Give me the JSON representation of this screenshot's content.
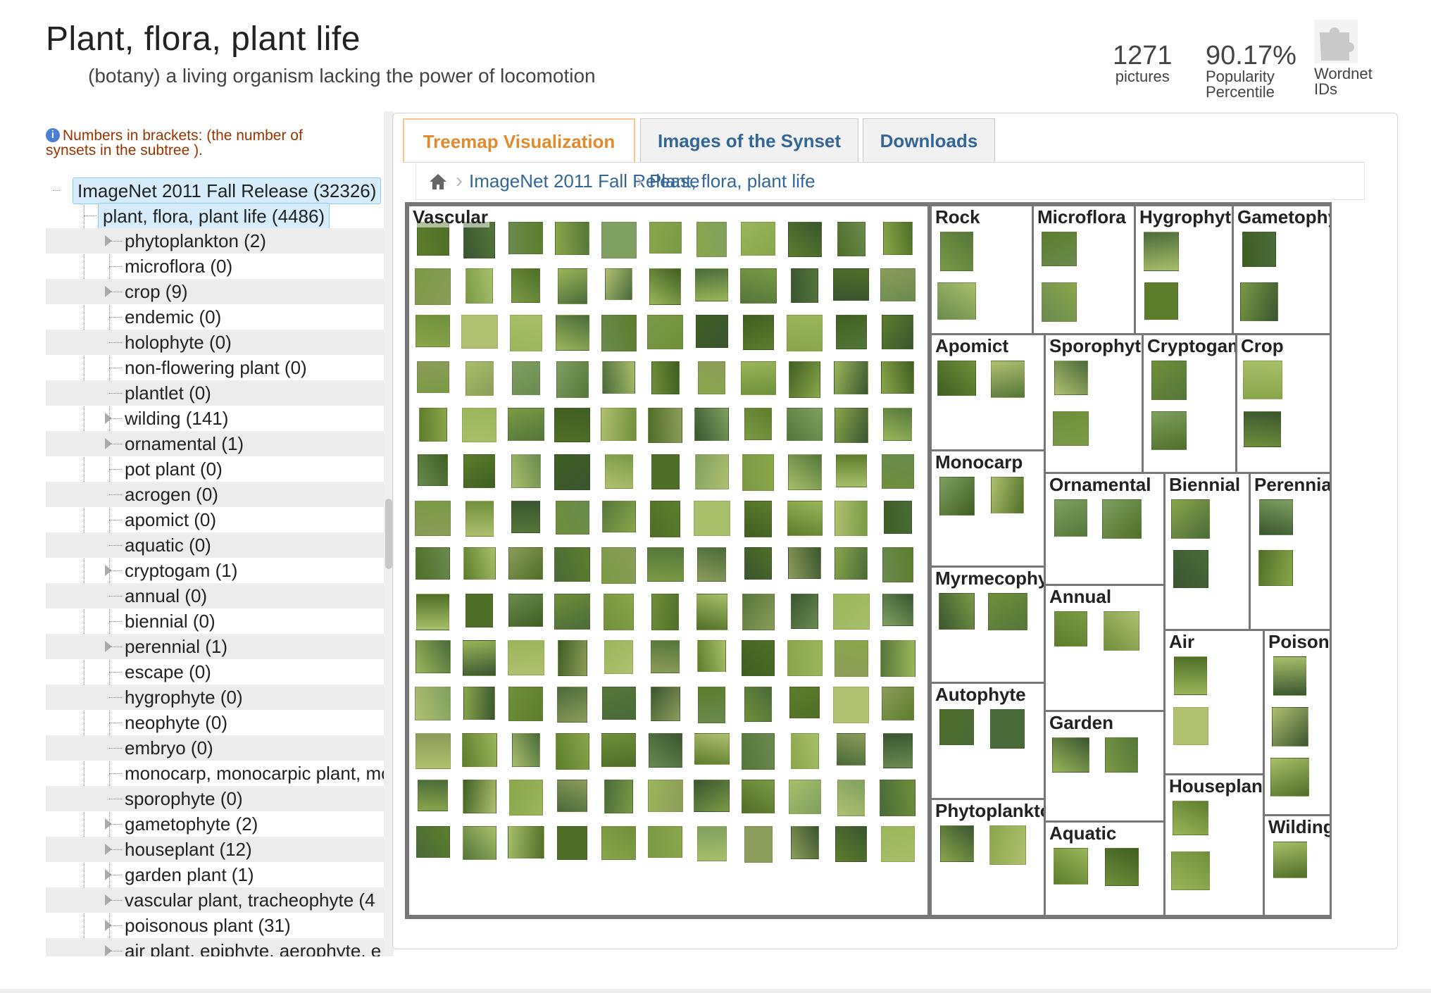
{
  "header": {
    "title": "Plant, flora, plant life",
    "gloss": "(botany) a living organism lacking the power of locomotion",
    "stats": {
      "pictures_count": "1271",
      "pictures_label": "pictures",
      "popularity_value": "90.17%",
      "popularity_label_1": "Popularity",
      "popularity_label_2": "Percentile",
      "wordnet_label_1": "Wordnet",
      "wordnet_label_2": "IDs"
    }
  },
  "tree": {
    "note": "Numbers in brackets: (the number of synsets in the subtree ).",
    "root": "ImageNet 2011 Fall Release (32326)",
    "current": "plant, flora, plant life (4486)",
    "children": [
      {
        "label": "phytoplankton (2)",
        "expandable": true
      },
      {
        "label": "microflora (0)",
        "expandable": false
      },
      {
        "label": "crop (9)",
        "expandable": true
      },
      {
        "label": "endemic (0)",
        "expandable": false
      },
      {
        "label": "holophyte (0)",
        "expandable": false
      },
      {
        "label": "non-flowering plant (0)",
        "expandable": false
      },
      {
        "label": "plantlet (0)",
        "expandable": false
      },
      {
        "label": "wilding (141)",
        "expandable": true
      },
      {
        "label": "ornamental (1)",
        "expandable": true
      },
      {
        "label": "pot plant (0)",
        "expandable": false
      },
      {
        "label": "acrogen (0)",
        "expandable": false
      },
      {
        "label": "apomict (0)",
        "expandable": false
      },
      {
        "label": "aquatic (0)",
        "expandable": false
      },
      {
        "label": "cryptogam (1)",
        "expandable": true
      },
      {
        "label": "annual (0)",
        "expandable": false
      },
      {
        "label": "biennial (0)",
        "expandable": false
      },
      {
        "label": "perennial (1)",
        "expandable": true
      },
      {
        "label": "escape (0)",
        "expandable": false
      },
      {
        "label": "hygrophyte (0)",
        "expandable": false
      },
      {
        "label": "neophyte (0)",
        "expandable": false
      },
      {
        "label": "embryo (0)",
        "expandable": false
      },
      {
        "label": "monocarp, monocarpic plant, mo",
        "expandable": false
      },
      {
        "label": "sporophyte (0)",
        "expandable": false
      },
      {
        "label": "gametophyte (2)",
        "expandable": true
      },
      {
        "label": "houseplant (12)",
        "expandable": true
      },
      {
        "label": "garden plant (1)",
        "expandable": true
      },
      {
        "label": "vascular plant, tracheophyte (4",
        "expandable": true
      },
      {
        "label": "poisonous plant (31)",
        "expandable": true
      },
      {
        "label": "air plant, epiphyte, aerophyte, e",
        "expandable": true
      }
    ]
  },
  "tabs": [
    {
      "label": "Treemap Visualization",
      "active": true
    },
    {
      "label": "Images of the Synset",
      "active": false
    },
    {
      "label": "Downloads",
      "active": false
    }
  ],
  "breadcrumb": {
    "items": [
      "ImageNet 2011 Fall Release",
      "Plant, flora, plant life"
    ]
  },
  "treemap": {
    "cells": [
      "Vascular",
      "Rock",
      "Microflora",
      "Hygrophyte",
      "Gametophyte",
      "Apomict",
      "Sporophyte",
      "Cryptogam",
      "Crop",
      "Monocarp",
      "Ornamental",
      "Biennial",
      "Perennial",
      "Myrmecophyte",
      "Annual",
      "Air",
      "Poisonous",
      "Autophyte",
      "Garden",
      "Phytoplankton",
      "Aquatic",
      "Houseplant",
      "Wilding"
    ]
  }
}
